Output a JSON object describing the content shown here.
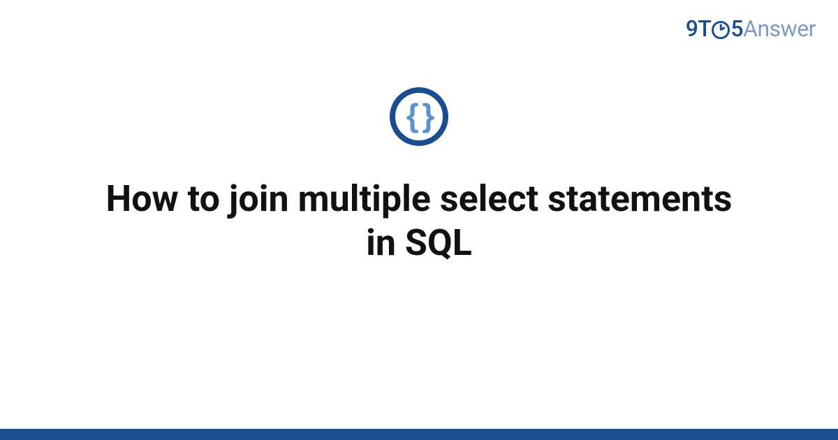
{
  "brand": {
    "prefix": "9T",
    "middle": "5",
    "suffix": "Answer"
  },
  "hero": {
    "icon_glyph": "{ }",
    "icon_name": "code-braces-icon"
  },
  "title": "How to join multiple select statements in SQL",
  "colors": {
    "primary": "#1a4d8f",
    "secondary": "#5d93c9",
    "muted": "#7a9cc6"
  }
}
